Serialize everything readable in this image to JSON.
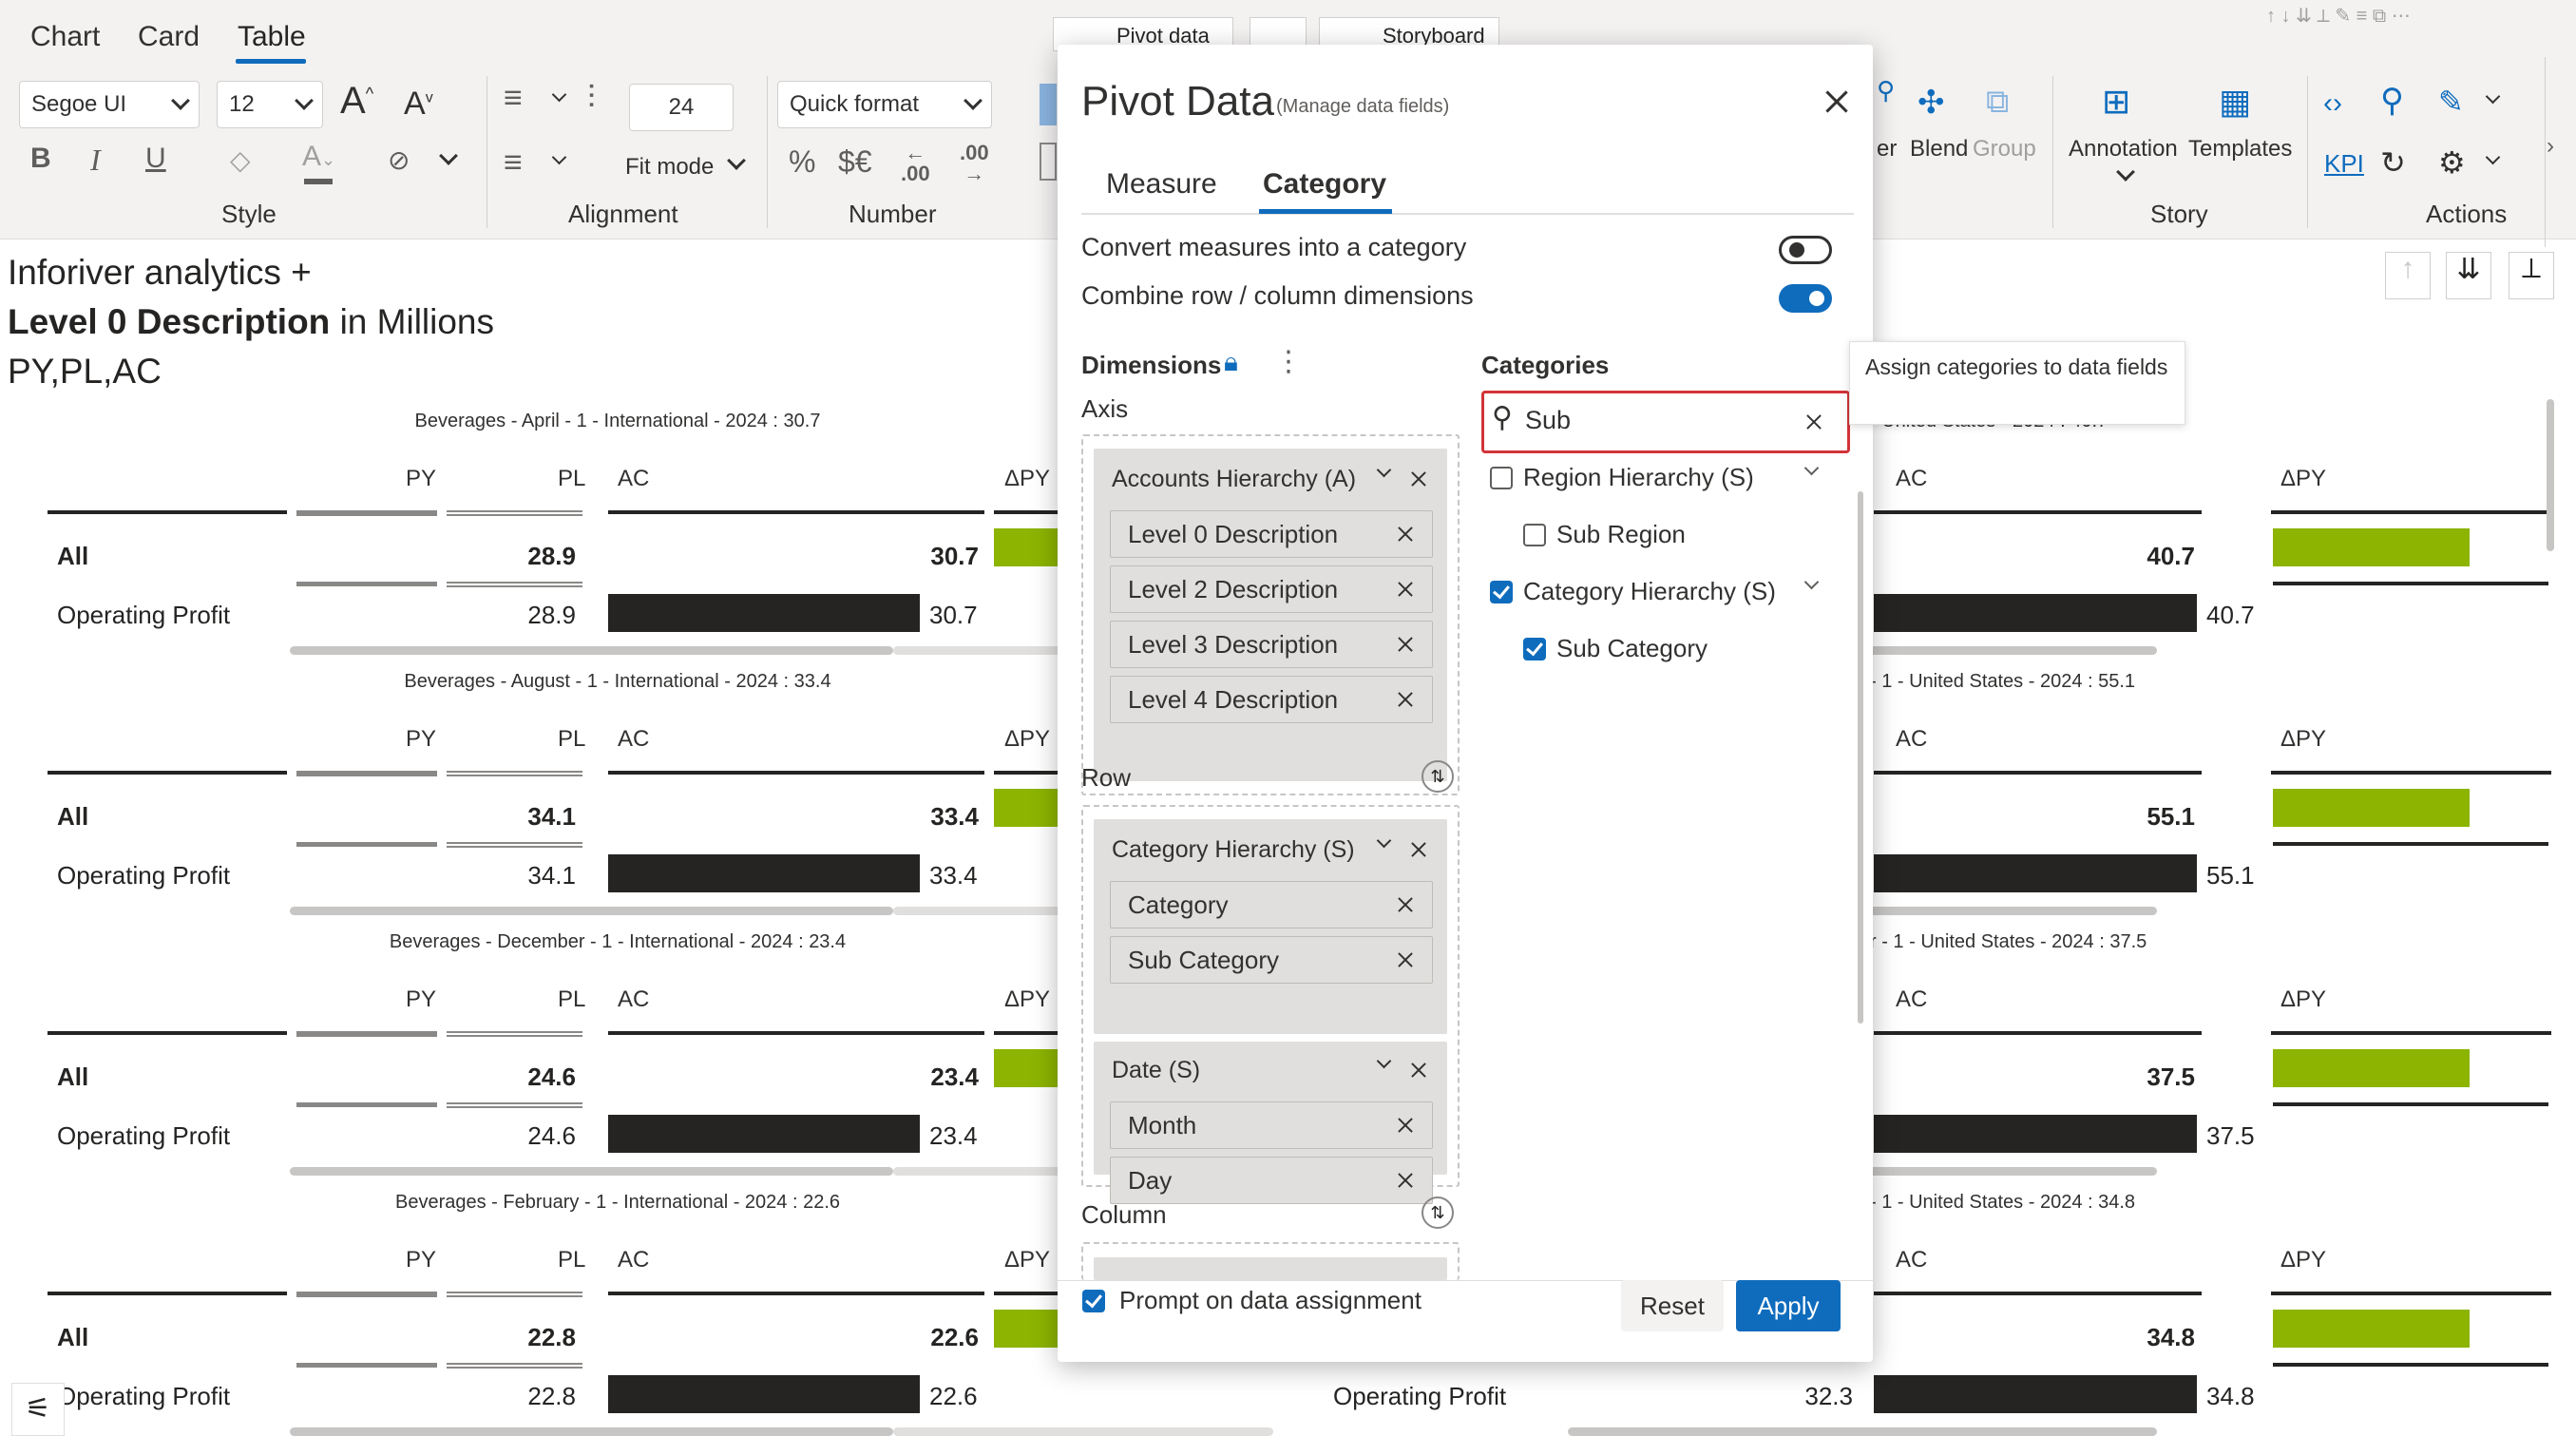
{
  "ribbon": {
    "tabs": [
      "Chart",
      "Card",
      "Table"
    ],
    "active_tab": "Table",
    "top_tabs": [
      "Pivot data",
      "",
      "Storyboard"
    ],
    "style": {
      "font_family": "Segoe UI",
      "font_size": "12",
      "group_label": "Style"
    },
    "alignment": {
      "line_height": "24",
      "fit_mode": "Fit mode",
      "group_label": "Alignment"
    },
    "number": {
      "quick_format": "Quick format",
      "group_label": "Number"
    },
    "right": {
      "filter_partial": "er",
      "blend": "Blend",
      "group": "Group",
      "annotation": "Annotation",
      "templates": "Templates",
      "story_label": "Story",
      "kpi": "KPI",
      "actions_label": "Actions"
    }
  },
  "report": {
    "title_line1": "Inforiver analytics +",
    "title_line2_bold": "Level 0 Description",
    "title_line2_rest": " in Millions",
    "title_line3": "PY,PL,AC",
    "headers": {
      "py": "PY",
      "pl": "PL",
      "ac": "AC",
      "dpy": "ΔPY"
    },
    "left_cards": [
      {
        "caption": "Beverages - April - 1 - International - 2024 :  30.7",
        "all_label": "All",
        "all_pl": "28.9",
        "all_ac": "30.7",
        "op_label": "Operating Profit",
        "op_pl": "28.9",
        "op_ac": "30.7",
        "ac_fraction": 0.95
      },
      {
        "caption": "Beverages - August - 1 - International - 2024 :  33.4",
        "all_label": "All",
        "all_pl": "34.1",
        "all_ac": "33.4",
        "op_label": "Operating Profit",
        "op_pl": "34.1",
        "op_ac": "33.4",
        "ac_fraction": 0.95
      },
      {
        "caption": "Beverages - December - 1 - International - 2024 :  23.4",
        "all_label": "All",
        "all_pl": "24.6",
        "all_ac": "23.4",
        "op_label": "Operating Profit",
        "op_pl": "24.6",
        "op_ac": "23.4",
        "ac_fraction": 0.95
      },
      {
        "caption": "Beverages - February - 1 - International - 2024 :  22.6",
        "all_label": "All",
        "all_pl": "22.8",
        "all_ac": "22.6",
        "op_label": "Operating Profit",
        "op_pl": "22.8",
        "op_ac": "22.6",
        "ac_fraction": 0.95
      }
    ],
    "right_cards": [
      {
        "caption": "- United States - 2024 :  40.7",
        "all_ac": "40.7",
        "op_ac": "40.7",
        "op_label": "",
        "op_pl": ""
      },
      {
        "caption": "- 1 - United States - 2024 :  55.1",
        "all_ac": "55.1",
        "op_ac": "55.1",
        "op_label": "",
        "op_pl": ""
      },
      {
        "caption": "r - 1 - United States - 2024 :  37.5",
        "all_ac": "37.5",
        "op_ac": "37.5",
        "op_label": "",
        "op_pl": ""
      },
      {
        "caption": "- 1 - United States - 2024 :  34.8",
        "all_ac": "34.8",
        "op_ac": "34.8",
        "op_label": "Operating Profit",
        "op_pl": "32.3"
      }
    ]
  },
  "dialog": {
    "title": "Pivot Data",
    "subtitle": "(Manage data fields)",
    "tabs": [
      "Measure",
      "Category"
    ],
    "active_tab": "Category",
    "convert_label": "Convert measures into a category",
    "convert_on": false,
    "combine_label": "Combine row / column dimensions",
    "combine_on": true,
    "dimensions_label": "Dimensions",
    "axis_label": "Axis",
    "axis_hierarchy": "Accounts Hierarchy (A)",
    "axis_items": [
      "Level 0 Description",
      "Level 2 Description",
      "Level 3 Description",
      "Level 4 Description"
    ],
    "row_label": "Row",
    "row_hierarchy": "Category Hierarchy (S)",
    "row_items": [
      "Category",
      "Sub Category"
    ],
    "date_hierarchy": "Date (S)",
    "date_items": [
      "Month",
      "Day"
    ],
    "column_label": "Column",
    "categories_label": "Categories",
    "search_value": "Sub",
    "category_tree": [
      {
        "label": "Region Hierarchy (S)",
        "checked": false
      },
      {
        "label": "Sub Region",
        "checked": false
      },
      {
        "label": "Category Hierarchy (S)",
        "checked": true
      },
      {
        "label": "Sub Category",
        "checked": true
      }
    ],
    "prompt_label": "Prompt on data assignment",
    "prompt_checked": true,
    "reset_label": "Reset",
    "apply_label": "Apply"
  },
  "tooltip": {
    "text": "Assign categories to data fields"
  },
  "colors": {
    "accent": "#0f6cbd",
    "positive_bar": "#8cb400",
    "ac_bar": "#252423",
    "search_highlight": "#d13438"
  }
}
